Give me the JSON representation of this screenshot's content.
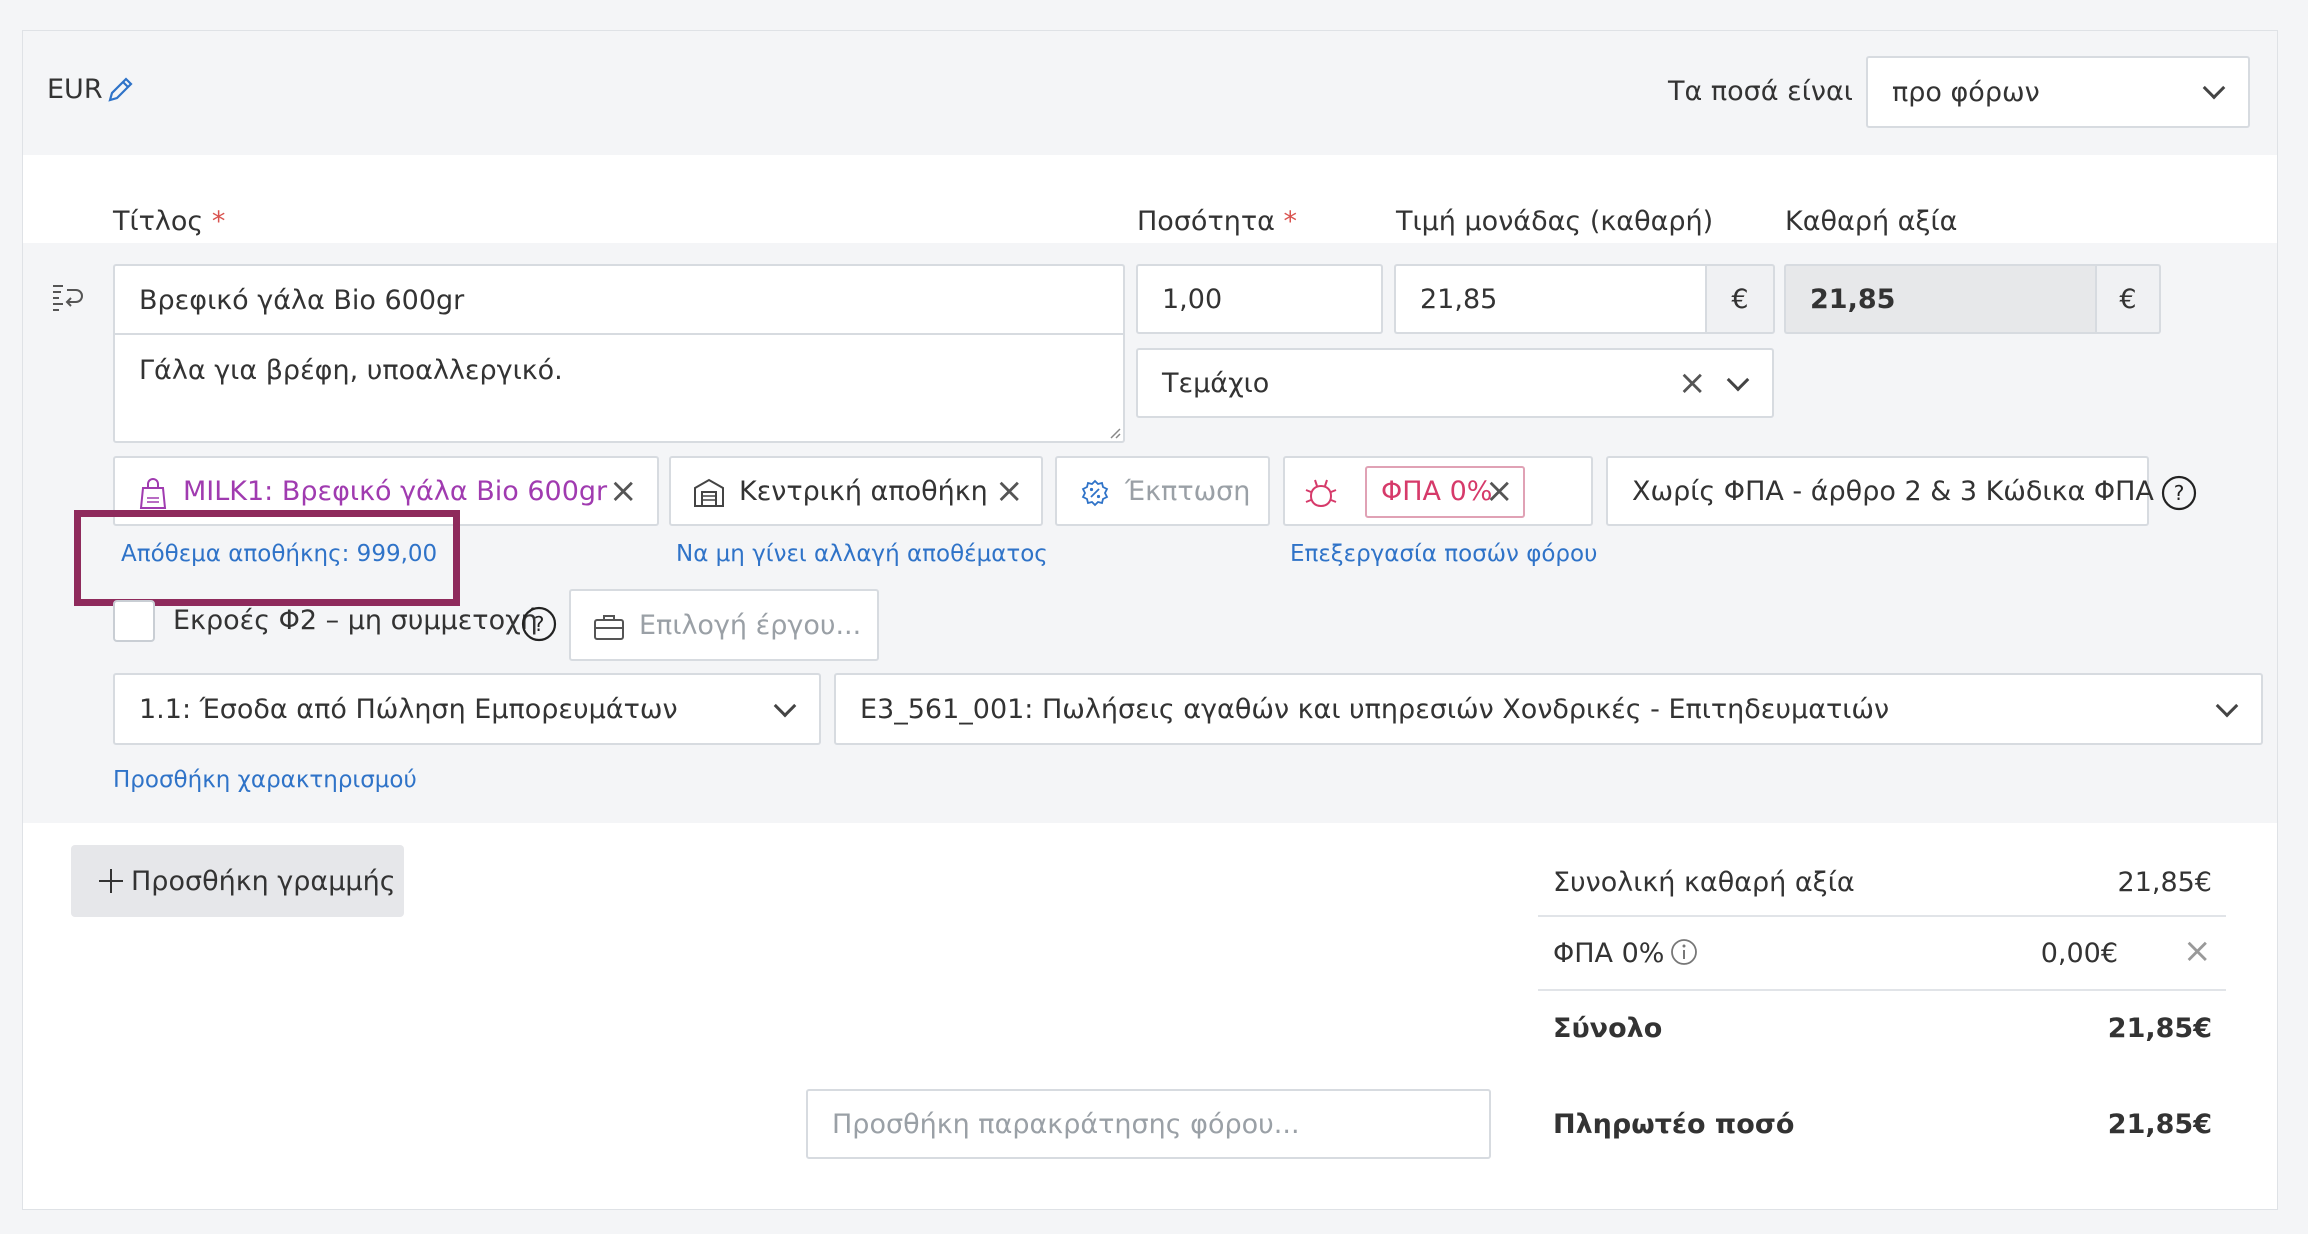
{
  "header": {
    "currency": "EUR",
    "amounts_label": "Τα ποσά είναι",
    "amounts_value": "προ φόρων"
  },
  "columns": {
    "title": "Τίτλος",
    "required_mark": "*",
    "quantity": "Ποσότητα",
    "unit_price": "Τιμή μονάδας (καθαρή)",
    "net_value": "Καθαρή αξία"
  },
  "line": {
    "title": "Βρεφικό γάλα Bio 600gr",
    "description": "Γάλα για βρέφη, υποαλλεργικό.",
    "quantity": "1,00",
    "unit_price": "21,85",
    "currency_symbol": "€",
    "net_value": "21,85",
    "unit": "Τεμάχιο",
    "product_chip": "MILK1: Βρεφικό γάλα Bio 600gr",
    "stock_link": "Απόθεμα αποθήκης: 999,00",
    "warehouse_chip": "Κεντρική αποθήκη",
    "warehouse_link": "Να μη γίνει αλλαγή αποθέματος",
    "discount_placeholder": "Έκπτωση",
    "vat_chip": "ΦΠΑ 0%",
    "tax_link": "Επεξεργασία ποσών φόρου",
    "vat_exemption": "Χωρίς ΦΠΑ - άρθρο 2 & 3 Κώδικα ΦΠΑ",
    "outflow_label": "Εκροές Φ2 – μη συμμετοχή",
    "project_placeholder": "Επιλογή έργου...",
    "classification_category": "1.1: Έσοδα από Πώληση Εμπορευμάτων",
    "classification_type": "E3_561_001: Πωλήσεις αγαθών και υπηρεσιών Χονδρικές - Επιτηδευματιών",
    "add_classification": "Προσθήκη χαρακτηρισμού"
  },
  "footer": {
    "add_line": "Προσθήκη γραμμής",
    "withholding_placeholder": "Προσθήκη παρακράτησης φόρου...",
    "summary": {
      "net_label": "Συνολική καθαρή αξία",
      "net_value": "21,85€",
      "vat_label": "ΦΠΑ 0%",
      "vat_value": "0,00€",
      "total_label": "Σύνολο",
      "total_value": "21,85€",
      "payable_label": "Πληρωτέο ποσό",
      "payable_value": "21,85€"
    }
  },
  "colors": {
    "highlight_box": "#8e2a5c",
    "link": "#2f73c8",
    "product_chip": "#a03bb0",
    "vat_chip": "#d63a6a"
  },
  "icons": [
    "pencil-icon",
    "drag-handle-icon",
    "bag-icon",
    "warehouse-icon",
    "discount-icon",
    "tax-icon",
    "help-icon",
    "briefcase-icon",
    "info-icon",
    "plus-icon",
    "chevron-down-icon",
    "close-icon"
  ]
}
